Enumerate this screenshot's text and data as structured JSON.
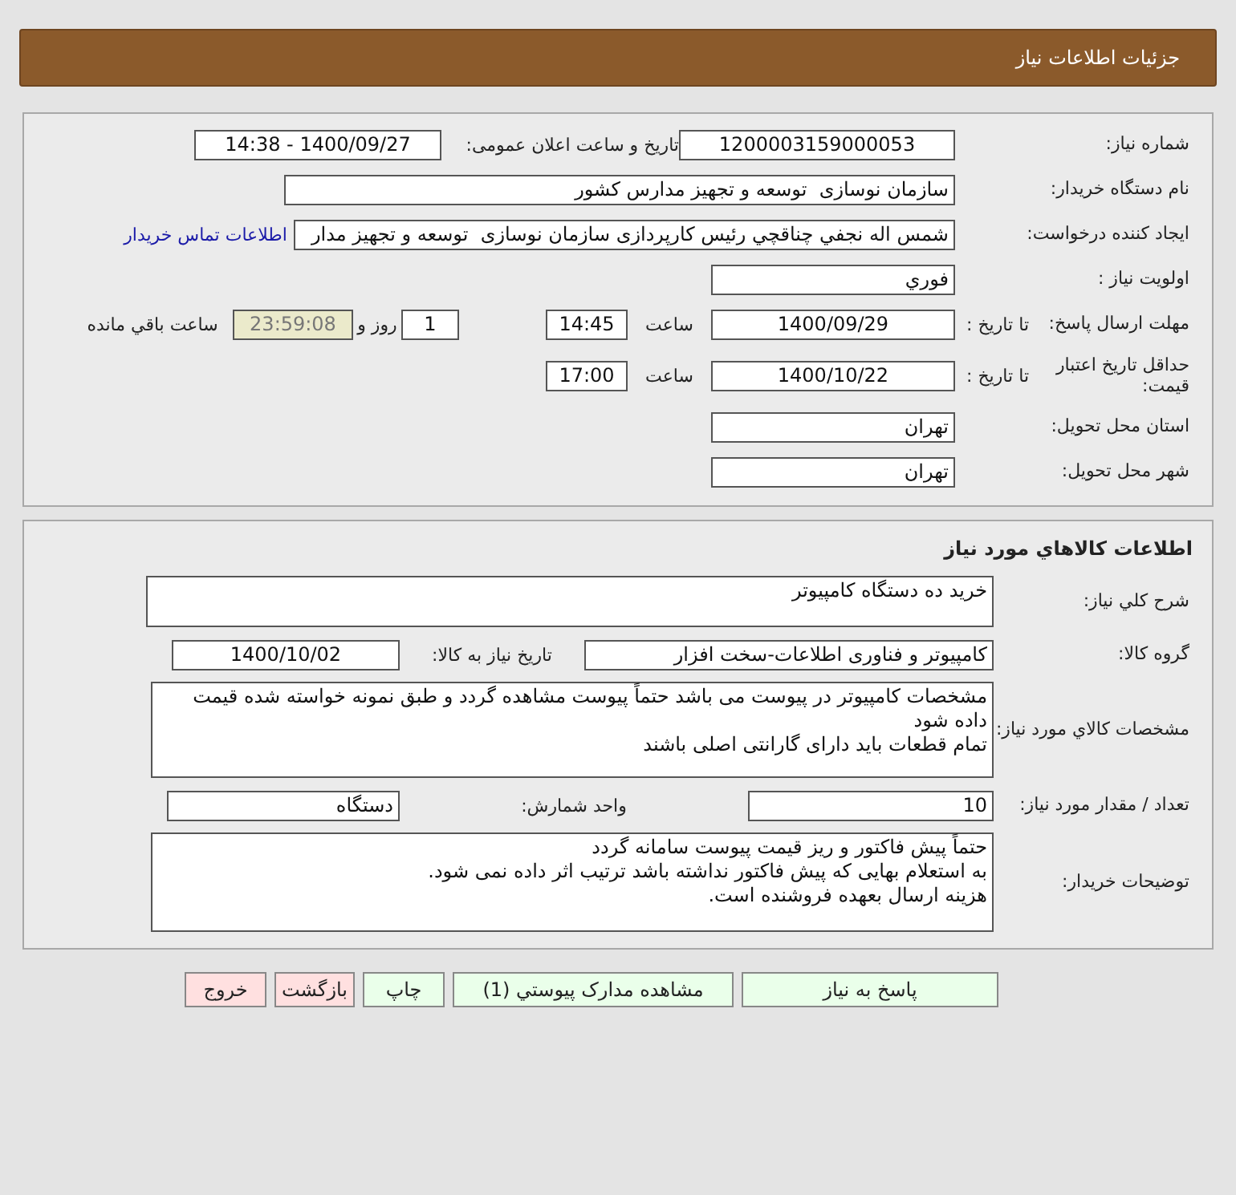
{
  "header": {
    "title": "جزئیات اطلاعات نیاز"
  },
  "need": {
    "number": {
      "label": "شماره نیاز:",
      "value": "1200003159000053"
    },
    "announce": {
      "label": "تاریخ و ساعت اعلان عمومی:",
      "value": "1400/09/27 - 14:38"
    },
    "buyer": {
      "label": "نام دستگاه خریدار:",
      "value": "سازمان نوسازی  توسعه و تجهیز مدارس کشور"
    },
    "requester": {
      "label": "ایجاد کننده درخواست:",
      "value": "شمس اله نجفي چناقچي رئيس کارپردازی سازمان نوسازی  توسعه و تجهیز مدار",
      "contact_link": "اطلاعات تماس خریدار"
    },
    "priority": {
      "label": "اولویت نیاز :",
      "value": "فوري"
    },
    "deadline": {
      "label": "مهلت ارسال پاسخ:",
      "to_label": "تا تاریخ :",
      "date": "1400/09/29",
      "time_label": "ساعت",
      "time": "14:45",
      "days": "1",
      "days_label": "روز و",
      "remaining": "23:59:08",
      "remaining_label": "ساعت باقي مانده"
    },
    "validity": {
      "label": "حداقل تاریخ اعتبار قیمت:",
      "to_label": "تا تاریخ :",
      "date": "1400/10/22",
      "time_label": "ساعت",
      "time": "17:00"
    },
    "province": {
      "label": "استان محل تحویل:",
      "value": "تهران"
    },
    "city": {
      "label": "شهر محل تحویل:",
      "value": "تهران"
    }
  },
  "goods": {
    "title": "اطلاعات کالاهاي مورد نیاز",
    "summary": {
      "label": "شرح کلي نیاز:",
      "value": "خرید ده دستگاه کامپیوتر"
    },
    "group": {
      "label": "گروه کالا:",
      "value": "کامپیوتر و فناوری اطلاعات-سخت افزار",
      "date_label": "تاریخ نیاز به کالا:",
      "date": "1400/10/02"
    },
    "specs": {
      "label": "مشخصات کالاي مورد نیاز:",
      "value": "مشخصات کامپیوتر در پیوست می باشد حتماً پیوست مشاهده گردد و طبق نمونه خواسته شده قیمت داده شود\nتمام قطعات باید دارای گارانتی اصلی باشند"
    },
    "quantity": {
      "label": "تعداد / مقدار مورد نیاز:",
      "value": "10",
      "unit_label": "واحد شمارش:",
      "unit": "دستگاه"
    },
    "notes": {
      "label": "توضیحات خریدار:",
      "value": "حتماً پیش فاکتور و ریز قیمت پیوست سامانه گردد\nبه استعلام بهایی که پیش فاکتور نداشته باشد ترتیب اثر داده نمی شود.\nهزینه ارسال بعهده فروشنده است."
    }
  },
  "buttons": [
    {
      "label": "پاسخ به نیاز",
      "kind": "primary"
    },
    {
      "label": "مشاهده مدارک پیوستي (1)",
      "kind": "primary"
    },
    {
      "label": "چاپ",
      "kind": "primary"
    },
    {
      "label": "بازگشت",
      "kind": "danger"
    },
    {
      "label": "خروج",
      "kind": "danger"
    }
  ]
}
